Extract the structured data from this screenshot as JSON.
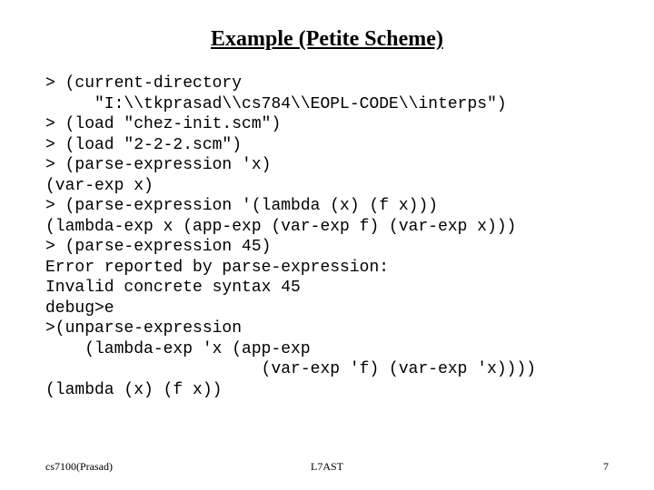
{
  "title": "Example (Petite Scheme)",
  "code_lines": [
    "> (current-directory",
    "     \"I:\\\\tkprasad\\\\cs784\\\\EOPL-CODE\\\\interps\")",
    "> (load \"chez-init.scm\")",
    "> (load \"2-2-2.scm\")",
    "> (parse-expression 'x)",
    "(var-exp x)",
    "> (parse-expression '(lambda (x) (f x)))",
    "(lambda-exp x (app-exp (var-exp f) (var-exp x)))",
    "> (parse-expression 45)",
    "Error reported by parse-expression:",
    "Invalid concrete syntax 45",
    "debug>e",
    ">(unparse-expression",
    "    (lambda-exp 'x (app-exp",
    "                      (var-exp 'f) (var-exp 'x))))",
    "(lambda (x) (f x))"
  ],
  "footer": {
    "left": "cs7100(Prasad)",
    "center": "L7AST",
    "right": "7"
  }
}
